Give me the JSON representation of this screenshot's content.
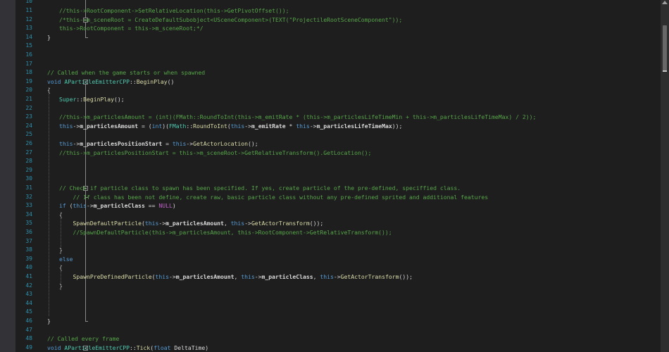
{
  "editor": {
    "colors": {
      "background": "#1e1e1e",
      "line_number": "#2b91af",
      "comment": "#57a64a",
      "keyword": "#569cd6",
      "type": "#4ec9b0",
      "function": "#dcdcaa",
      "string": "#d69d85",
      "macro": "#bd63c5"
    },
    "lines": [
      {
        "num": "10",
        "tokens": []
      },
      {
        "num": "11",
        "tokens": [
          {
            "t": "//this->RootComponent->SetRelativeLocation(this->GetPivotOffset());",
            "c": "comment"
          }
        ]
      },
      {
        "num": "12",
        "tokens": [
          {
            "t": "/*this->m_sceneRoot = CreateDefaultSubobject<USceneComponent>(TEXT(\"ProjectileRootSceneComponent\"));",
            "c": "comment"
          }
        ]
      },
      {
        "num": "13",
        "tokens": [
          {
            "t": "this->RootComponent = this->m_sceneRoot;*/",
            "c": "comment"
          }
        ]
      },
      {
        "num": "14",
        "tokens": [
          {
            "t": "}",
            "c": "plain"
          }
        ]
      },
      {
        "num": "15",
        "tokens": []
      },
      {
        "num": "16",
        "tokens": []
      },
      {
        "num": "17",
        "tokens": []
      },
      {
        "num": "18",
        "tokens": [
          {
            "t": "// Called when the game starts or when spawned",
            "c": "comment"
          }
        ]
      },
      {
        "num": "19",
        "tokens": [
          {
            "t": "void ",
            "c": "kw"
          },
          {
            "t": "AParticleEmitterCPP",
            "c": "type"
          },
          {
            "t": "::",
            "c": "plain"
          },
          {
            "t": "BeginPlay",
            "c": "fn"
          },
          {
            "t": "()",
            "c": "plain"
          }
        ]
      },
      {
        "num": "20",
        "tokens": [
          {
            "t": "{",
            "c": "plain"
          }
        ]
      },
      {
        "num": "21",
        "tokens": [
          {
            "t": "Super",
            "c": "type"
          },
          {
            "t": "::",
            "c": "plain"
          },
          {
            "t": "BeginPlay",
            "c": "fn"
          },
          {
            "t": "();",
            "c": "plain"
          }
        ]
      },
      {
        "num": "22",
        "tokens": []
      },
      {
        "num": "23",
        "tokens": [
          {
            "t": "//this->m_particlesAmount = (int)(FMath::RoundToInt(this->m_emitRate * (this->m_particlesLifeTimeMin + this->m_particlesLifeTimeMax) / 2));",
            "c": "comment"
          }
        ]
      },
      {
        "num": "24",
        "tokens": [
          {
            "t": "this",
            "c": "kw"
          },
          {
            "t": "->",
            "c": "plain"
          },
          {
            "t": "m_particlesAmount",
            "c": "member"
          },
          {
            "t": " = (",
            "c": "plain"
          },
          {
            "t": "int",
            "c": "kw"
          },
          {
            "t": ")(",
            "c": "plain"
          },
          {
            "t": "FMath",
            "c": "type"
          },
          {
            "t": "::",
            "c": "plain"
          },
          {
            "t": "RoundToInt",
            "c": "fn"
          },
          {
            "t": "(",
            "c": "plain"
          },
          {
            "t": "this",
            "c": "kw"
          },
          {
            "t": "->",
            "c": "plain"
          },
          {
            "t": "m_emitRate",
            "c": "member"
          },
          {
            "t": " * ",
            "c": "plain"
          },
          {
            "t": "this",
            "c": "kw"
          },
          {
            "t": "->",
            "c": "plain"
          },
          {
            "t": "m_particlesLifeTimeMax",
            "c": "member"
          },
          {
            "t": "));",
            "c": "plain"
          }
        ]
      },
      {
        "num": "25",
        "tokens": []
      },
      {
        "num": "26",
        "tokens": [
          {
            "t": "this",
            "c": "kw"
          },
          {
            "t": "->",
            "c": "plain"
          },
          {
            "t": "m_particlesPositionStart",
            "c": "member"
          },
          {
            "t": " = ",
            "c": "plain"
          },
          {
            "t": "this",
            "c": "kw"
          },
          {
            "t": "->",
            "c": "plain"
          },
          {
            "t": "GetActorLocation",
            "c": "fn"
          },
          {
            "t": "();",
            "c": "plain"
          }
        ]
      },
      {
        "num": "27",
        "tokens": [
          {
            "t": "//this->m_particlesPositionStart = this->m_sceneRoot->GetRelativeTransform().GetLocation();",
            "c": "comment"
          }
        ]
      },
      {
        "num": "28",
        "tokens": []
      },
      {
        "num": "29",
        "tokens": []
      },
      {
        "num": "30",
        "tokens": []
      },
      {
        "num": "31",
        "tokens": [
          {
            "t": "// Check if particle class to spawn has been specified. If yes, create particle of the pre-defined, speciffied class.",
            "c": "comment"
          }
        ]
      },
      {
        "num": "32",
        "tokens": [
          {
            "t": "    // If class has been not define, create raw, basic particle class without any pre-defined sprited and additional features",
            "c": "comment"
          }
        ]
      },
      {
        "num": "33",
        "tokens": [
          {
            "t": "if ",
            "c": "kw"
          },
          {
            "t": "(",
            "c": "plain"
          },
          {
            "t": "this",
            "c": "kw"
          },
          {
            "t": "->",
            "c": "plain"
          },
          {
            "t": "m_particleClass",
            "c": "member"
          },
          {
            "t": " == ",
            "c": "plain"
          },
          {
            "t": "NULL",
            "c": "macro"
          },
          {
            "t": ")",
            "c": "plain"
          }
        ]
      },
      {
        "num": "34",
        "tokens": [
          {
            "t": "{",
            "c": "plain"
          }
        ]
      },
      {
        "num": "35",
        "tokens": [
          {
            "t": "    ",
            "c": "plain"
          },
          {
            "t": "SpawnDefaultParticle",
            "c": "fn"
          },
          {
            "t": "(",
            "c": "plain"
          },
          {
            "t": "this",
            "c": "kw"
          },
          {
            "t": "->",
            "c": "plain"
          },
          {
            "t": "m_particlesAmount",
            "c": "member"
          },
          {
            "t": ", ",
            "c": "plain"
          },
          {
            "t": "this",
            "c": "kw"
          },
          {
            "t": "->",
            "c": "plain"
          },
          {
            "t": "GetActorTransform",
            "c": "fn"
          },
          {
            "t": "());",
            "c": "plain"
          }
        ]
      },
      {
        "num": "36",
        "tokens": [
          {
            "t": "    //SpawnDefaultParticle(this->m_particlesAmount, this->RootComponent->GetRelativeTransform());",
            "c": "comment"
          }
        ]
      },
      {
        "num": "37",
        "tokens": []
      },
      {
        "num": "38",
        "tokens": [
          {
            "t": "}",
            "c": "plain"
          }
        ]
      },
      {
        "num": "39",
        "tokens": [
          {
            "t": "else",
            "c": "kw"
          }
        ]
      },
      {
        "num": "40",
        "tokens": [
          {
            "t": "{",
            "c": "plain"
          }
        ]
      },
      {
        "num": "41",
        "tokens": [
          {
            "t": "    ",
            "c": "plain"
          },
          {
            "t": "SpawnPreDefinedParticle",
            "c": "fn"
          },
          {
            "t": "(",
            "c": "plain"
          },
          {
            "t": "this",
            "c": "kw"
          },
          {
            "t": "->",
            "c": "plain"
          },
          {
            "t": "m_particlesAmount",
            "c": "member"
          },
          {
            "t": ", ",
            "c": "plain"
          },
          {
            "t": "this",
            "c": "kw"
          },
          {
            "t": "->",
            "c": "plain"
          },
          {
            "t": "m_particleClass",
            "c": "member"
          },
          {
            "t": ", ",
            "c": "plain"
          },
          {
            "t": "this",
            "c": "kw"
          },
          {
            "t": "->",
            "c": "plain"
          },
          {
            "t": "GetActorTransform",
            "c": "fn"
          },
          {
            "t": "());",
            "c": "plain"
          }
        ]
      },
      {
        "num": "42",
        "tokens": [
          {
            "t": "}",
            "c": "plain"
          }
        ]
      },
      {
        "num": "43",
        "tokens": []
      },
      {
        "num": "44",
        "tokens": []
      },
      {
        "num": "45",
        "tokens": []
      },
      {
        "num": "46",
        "tokens": [
          {
            "t": "}",
            "c": "plain"
          }
        ]
      },
      {
        "num": "47",
        "tokens": []
      },
      {
        "num": "48",
        "tokens": [
          {
            "t": "// Called every frame",
            "c": "comment"
          }
        ]
      },
      {
        "num": "49",
        "tokens": [
          {
            "t": "void ",
            "c": "kw"
          },
          {
            "t": "AParticleEmitterCPP",
            "c": "type"
          },
          {
            "t": "::",
            "c": "plain"
          },
          {
            "t": "Tick",
            "c": "fn"
          },
          {
            "t": "(",
            "c": "plain"
          },
          {
            "t": "float ",
            "c": "kw"
          },
          {
            "t": "DeltaTime)",
            "c": "plain"
          }
        ]
      }
    ]
  }
}
